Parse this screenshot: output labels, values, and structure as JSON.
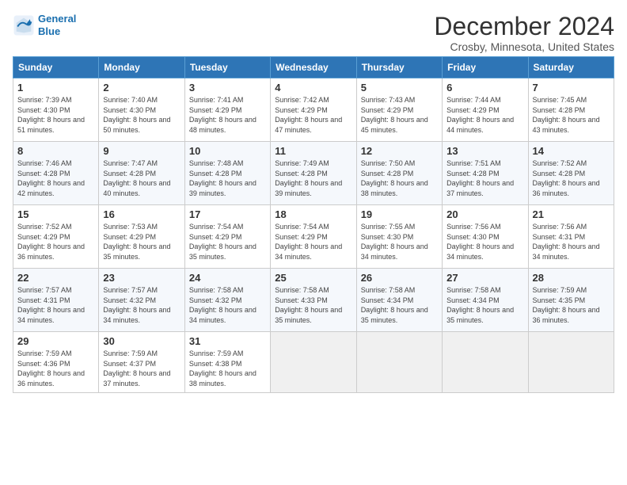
{
  "logo": {
    "line1": "General",
    "line2": "Blue"
  },
  "title": "December 2024",
  "subtitle": "Crosby, Minnesota, United States",
  "days_of_week": [
    "Sunday",
    "Monday",
    "Tuesday",
    "Wednesday",
    "Thursday",
    "Friday",
    "Saturday"
  ],
  "weeks": [
    [
      {
        "day": "1",
        "sunrise": "7:39 AM",
        "sunset": "4:30 PM",
        "daylight": "8 hours and 51 minutes."
      },
      {
        "day": "2",
        "sunrise": "7:40 AM",
        "sunset": "4:30 PM",
        "daylight": "8 hours and 50 minutes."
      },
      {
        "day": "3",
        "sunrise": "7:41 AM",
        "sunset": "4:29 PM",
        "daylight": "8 hours and 48 minutes."
      },
      {
        "day": "4",
        "sunrise": "7:42 AM",
        "sunset": "4:29 PM",
        "daylight": "8 hours and 47 minutes."
      },
      {
        "day": "5",
        "sunrise": "7:43 AM",
        "sunset": "4:29 PM",
        "daylight": "8 hours and 45 minutes."
      },
      {
        "day": "6",
        "sunrise": "7:44 AM",
        "sunset": "4:29 PM",
        "daylight": "8 hours and 44 minutes."
      },
      {
        "day": "7",
        "sunrise": "7:45 AM",
        "sunset": "4:28 PM",
        "daylight": "8 hours and 43 minutes."
      }
    ],
    [
      {
        "day": "8",
        "sunrise": "7:46 AM",
        "sunset": "4:28 PM",
        "daylight": "8 hours and 42 minutes."
      },
      {
        "day": "9",
        "sunrise": "7:47 AM",
        "sunset": "4:28 PM",
        "daylight": "8 hours and 40 minutes."
      },
      {
        "day": "10",
        "sunrise": "7:48 AM",
        "sunset": "4:28 PM",
        "daylight": "8 hours and 39 minutes."
      },
      {
        "day": "11",
        "sunrise": "7:49 AM",
        "sunset": "4:28 PM",
        "daylight": "8 hours and 39 minutes."
      },
      {
        "day": "12",
        "sunrise": "7:50 AM",
        "sunset": "4:28 PM",
        "daylight": "8 hours and 38 minutes."
      },
      {
        "day": "13",
        "sunrise": "7:51 AM",
        "sunset": "4:28 PM",
        "daylight": "8 hours and 37 minutes."
      },
      {
        "day": "14",
        "sunrise": "7:52 AM",
        "sunset": "4:28 PM",
        "daylight": "8 hours and 36 minutes."
      }
    ],
    [
      {
        "day": "15",
        "sunrise": "7:52 AM",
        "sunset": "4:29 PM",
        "daylight": "8 hours and 36 minutes."
      },
      {
        "day": "16",
        "sunrise": "7:53 AM",
        "sunset": "4:29 PM",
        "daylight": "8 hours and 35 minutes."
      },
      {
        "day": "17",
        "sunrise": "7:54 AM",
        "sunset": "4:29 PM",
        "daylight": "8 hours and 35 minutes."
      },
      {
        "day": "18",
        "sunrise": "7:54 AM",
        "sunset": "4:29 PM",
        "daylight": "8 hours and 34 minutes."
      },
      {
        "day": "19",
        "sunrise": "7:55 AM",
        "sunset": "4:30 PM",
        "daylight": "8 hours and 34 minutes."
      },
      {
        "day": "20",
        "sunrise": "7:56 AM",
        "sunset": "4:30 PM",
        "daylight": "8 hours and 34 minutes."
      },
      {
        "day": "21",
        "sunrise": "7:56 AM",
        "sunset": "4:31 PM",
        "daylight": "8 hours and 34 minutes."
      }
    ],
    [
      {
        "day": "22",
        "sunrise": "7:57 AM",
        "sunset": "4:31 PM",
        "daylight": "8 hours and 34 minutes."
      },
      {
        "day": "23",
        "sunrise": "7:57 AM",
        "sunset": "4:32 PM",
        "daylight": "8 hours and 34 minutes."
      },
      {
        "day": "24",
        "sunrise": "7:58 AM",
        "sunset": "4:32 PM",
        "daylight": "8 hours and 34 minutes."
      },
      {
        "day": "25",
        "sunrise": "7:58 AM",
        "sunset": "4:33 PM",
        "daylight": "8 hours and 35 minutes."
      },
      {
        "day": "26",
        "sunrise": "7:58 AM",
        "sunset": "4:34 PM",
        "daylight": "8 hours and 35 minutes."
      },
      {
        "day": "27",
        "sunrise": "7:58 AM",
        "sunset": "4:34 PM",
        "daylight": "8 hours and 35 minutes."
      },
      {
        "day": "28",
        "sunrise": "7:59 AM",
        "sunset": "4:35 PM",
        "daylight": "8 hours and 36 minutes."
      }
    ],
    [
      {
        "day": "29",
        "sunrise": "7:59 AM",
        "sunset": "4:36 PM",
        "daylight": "8 hours and 36 minutes."
      },
      {
        "day": "30",
        "sunrise": "7:59 AM",
        "sunset": "4:37 PM",
        "daylight": "8 hours and 37 minutes."
      },
      {
        "day": "31",
        "sunrise": "7:59 AM",
        "sunset": "4:38 PM",
        "daylight": "8 hours and 38 minutes."
      },
      null,
      null,
      null,
      null
    ]
  ]
}
